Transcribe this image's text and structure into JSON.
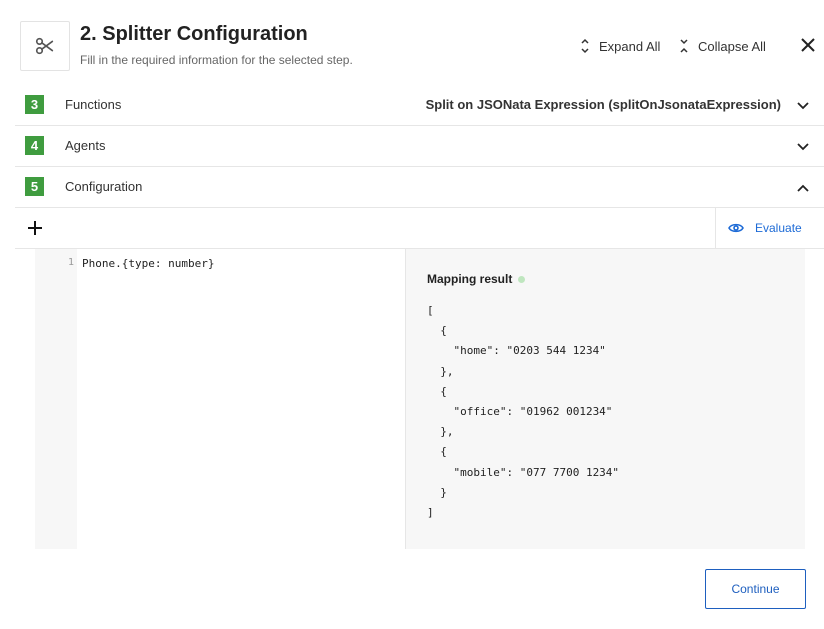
{
  "header": {
    "icon": "scissors-icon",
    "title": "2. Splitter Configuration",
    "subtitle": "Fill in the required information for the selected step.",
    "expand_label": "Expand All",
    "collapse_label": "Collapse All"
  },
  "steps": [
    {
      "num": "3",
      "label": "Functions",
      "value": "Split on JSONata Expression (splitOnJsonataExpression)",
      "state": "collapsed"
    },
    {
      "num": "4",
      "label": "Agents",
      "value": "",
      "state": "collapsed"
    },
    {
      "num": "5",
      "label": "Configuration",
      "value": "",
      "state": "expanded"
    }
  ],
  "toolbar": {
    "evaluate_label": "Evaluate"
  },
  "editor": {
    "line_number": "1",
    "code": "Phone.{type: number}"
  },
  "result": {
    "title": "Mapping result",
    "body": "[\n  {\n    \"home\": \"0203 544 1234\"\n  },\n  {\n    \"office\": \"01962 001234\"\n  },\n  {\n    \"mobile\": \"077 7700 1234\"\n  }\n]"
  },
  "footer": {
    "continue_label": "Continue"
  },
  "colors": {
    "step_badge": "#3f9c3f",
    "accent": "#1e6bd6",
    "status_dot": "#bfe6bf"
  }
}
